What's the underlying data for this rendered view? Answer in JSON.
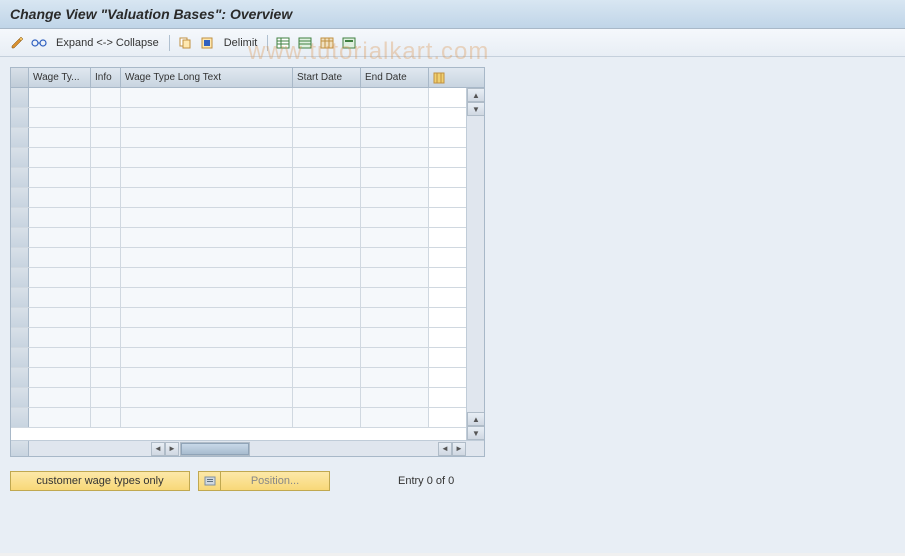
{
  "title": "Change View \"Valuation Bases\": Overview",
  "toolbar": {
    "expand_label": "Expand <-> Collapse",
    "delimit_label": "Delimit"
  },
  "table": {
    "columns": {
      "wage_type": "Wage Ty...",
      "info": "Info",
      "long_text": "Wage Type Long Text",
      "start_date": "Start Date",
      "end_date": "End Date"
    },
    "rows": [
      {
        "wt": "",
        "info": "",
        "long": "",
        "start": "",
        "end": ""
      },
      {
        "wt": "",
        "info": "",
        "long": "",
        "start": "",
        "end": ""
      },
      {
        "wt": "",
        "info": "",
        "long": "",
        "start": "",
        "end": ""
      },
      {
        "wt": "",
        "info": "",
        "long": "",
        "start": "",
        "end": ""
      },
      {
        "wt": "",
        "info": "",
        "long": "",
        "start": "",
        "end": ""
      },
      {
        "wt": "",
        "info": "",
        "long": "",
        "start": "",
        "end": ""
      },
      {
        "wt": "",
        "info": "",
        "long": "",
        "start": "",
        "end": ""
      },
      {
        "wt": "",
        "info": "",
        "long": "",
        "start": "",
        "end": ""
      },
      {
        "wt": "",
        "info": "",
        "long": "",
        "start": "",
        "end": ""
      },
      {
        "wt": "",
        "info": "",
        "long": "",
        "start": "",
        "end": ""
      },
      {
        "wt": "",
        "info": "",
        "long": "",
        "start": "",
        "end": ""
      },
      {
        "wt": "",
        "info": "",
        "long": "",
        "start": "",
        "end": ""
      },
      {
        "wt": "",
        "info": "",
        "long": "",
        "start": "",
        "end": ""
      },
      {
        "wt": "",
        "info": "",
        "long": "",
        "start": "",
        "end": ""
      },
      {
        "wt": "",
        "info": "",
        "long": "",
        "start": "",
        "end": ""
      },
      {
        "wt": "",
        "info": "",
        "long": "",
        "start": "",
        "end": ""
      },
      {
        "wt": "",
        "info": "",
        "long": "",
        "start": "",
        "end": ""
      }
    ]
  },
  "buttons": {
    "customer_wage": "customer wage types only",
    "position": "Position..."
  },
  "status": {
    "entry_text": "Entry 0 of 0"
  },
  "watermark": "www.tutorialkart.com"
}
